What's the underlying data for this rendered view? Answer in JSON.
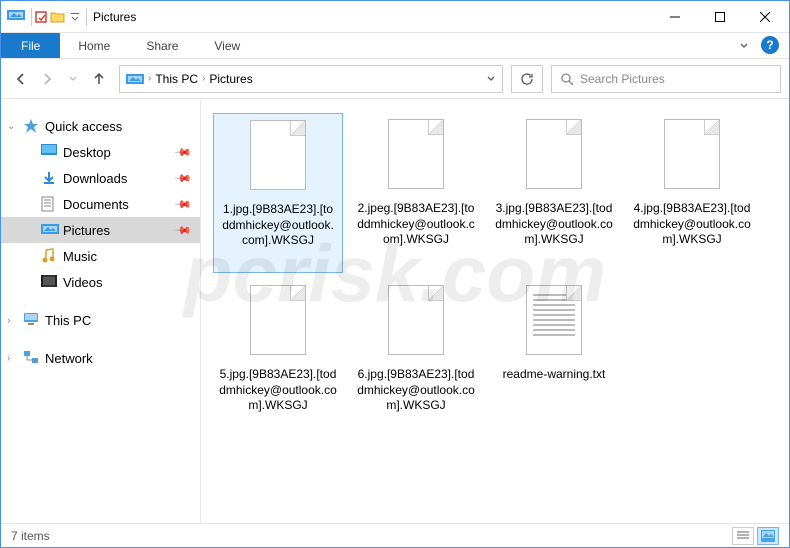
{
  "titlebar": {
    "title": "Pictures"
  },
  "ribbon": {
    "file": "File",
    "tabs": [
      "Home",
      "Share",
      "View"
    ]
  },
  "breadcrumb": {
    "items": [
      "This PC",
      "Pictures"
    ]
  },
  "search": {
    "placeholder": "Search Pictures"
  },
  "sidebar": {
    "quick_access": "Quick access",
    "items": [
      {
        "label": "Desktop",
        "pinned": true
      },
      {
        "label": "Downloads",
        "pinned": true
      },
      {
        "label": "Documents",
        "pinned": true
      },
      {
        "label": "Pictures",
        "pinned": true,
        "active": true
      },
      {
        "label": "Music",
        "pinned": false
      },
      {
        "label": "Videos",
        "pinned": false
      }
    ],
    "this_pc": "This PC",
    "network": "Network"
  },
  "files": [
    {
      "name": "1.jpg.[9B83AE23].[toddmhickey@outlook.com].WKSGJ",
      "type": "blank",
      "selected": true
    },
    {
      "name": "2.jpeg.[9B83AE23].[toddmhickey@outlook.com].WKSGJ",
      "type": "blank"
    },
    {
      "name": "3.jpg.[9B83AE23].[toddmhickey@outlook.com].WKSGJ",
      "type": "blank"
    },
    {
      "name": "4.jpg.[9B83AE23].[toddmhickey@outlook.com].WKSGJ",
      "type": "blank"
    },
    {
      "name": "5.jpg.[9B83AE23].[toddmhickey@outlook.com].WKSGJ",
      "type": "blank"
    },
    {
      "name": "6.jpg.[9B83AE23].[toddmhickey@outlook.com].WKSGJ",
      "type": "blank"
    },
    {
      "name": "readme-warning.txt",
      "type": "txt"
    }
  ],
  "status": {
    "count": "7 items"
  },
  "watermark": "pcrisk.com"
}
